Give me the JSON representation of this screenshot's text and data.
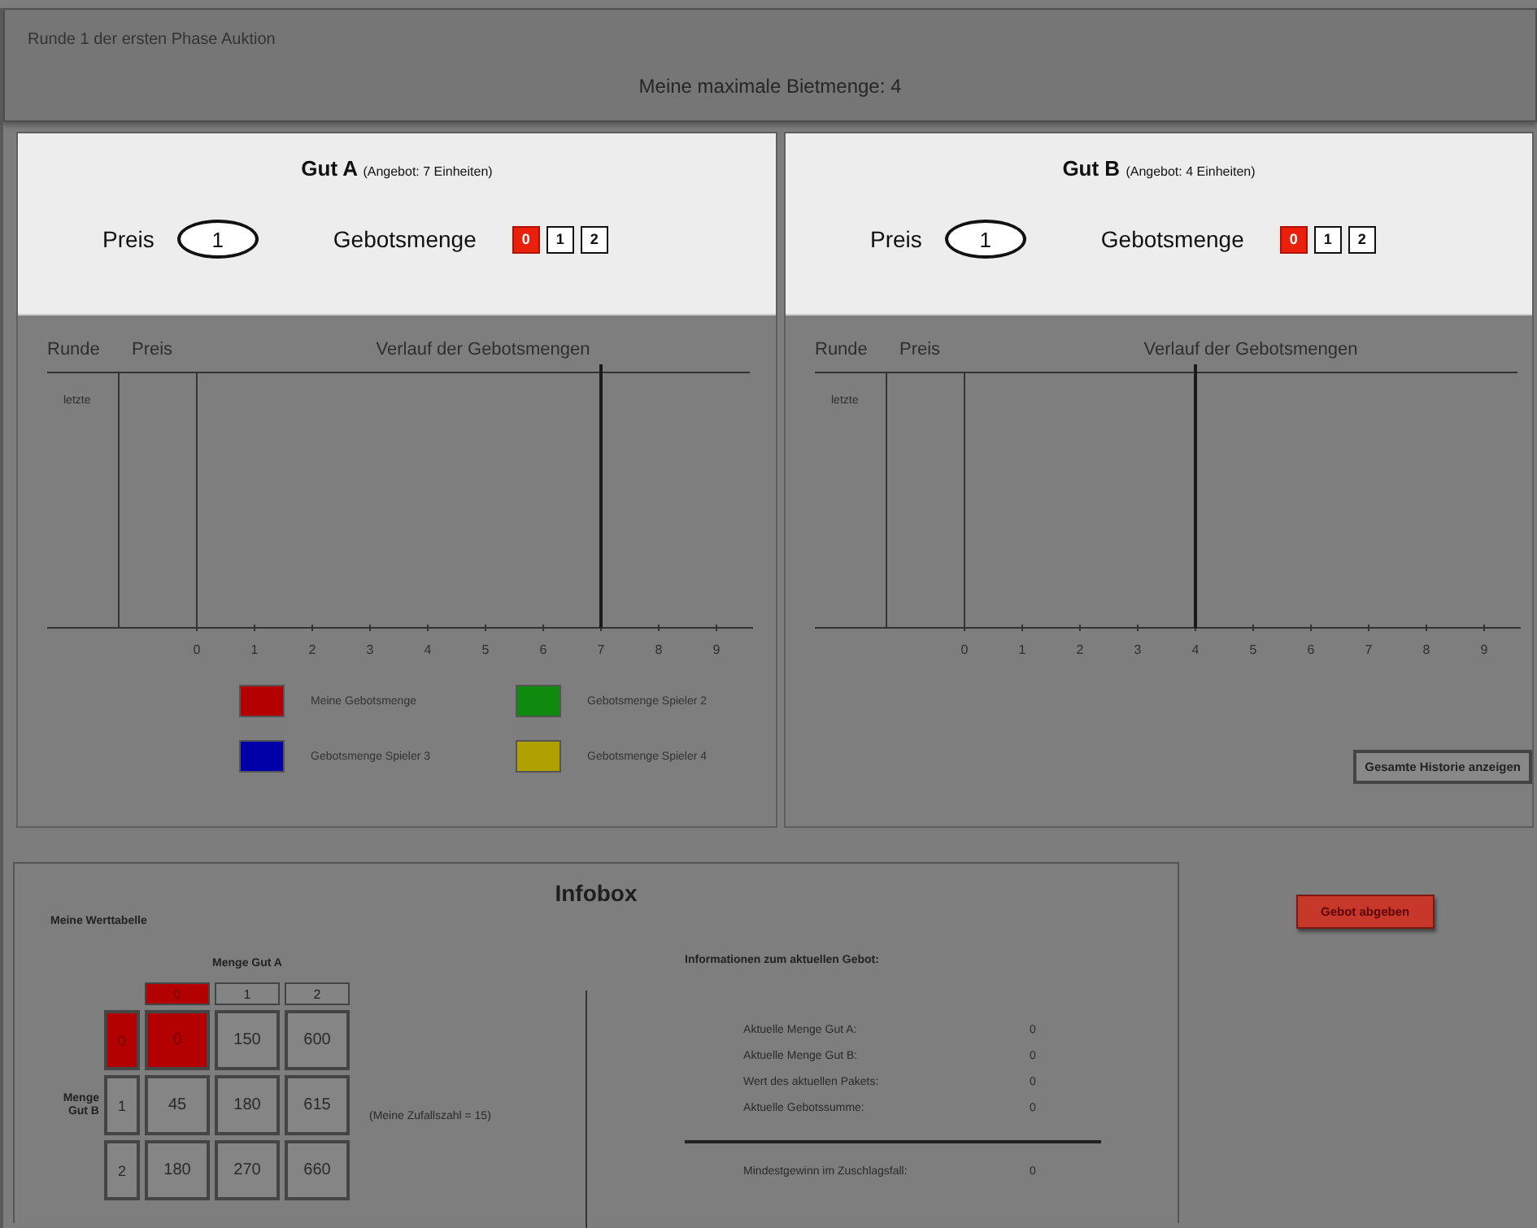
{
  "header": {
    "round_label": "Runde 1 der ersten Phase Auktion",
    "max_bid": "Meine maximale Bietmenge: 4"
  },
  "goods": [
    {
      "name": "Gut A",
      "supply": "(Angebot: 7 Einheiten)",
      "price_label": "Preis",
      "price": "1",
      "quantity_label": "Gebotsmenge",
      "quantities": [
        {
          "label": "0",
          "selected": true
        },
        {
          "label": "1",
          "selected": false
        },
        {
          "label": "2",
          "selected": false
        }
      ],
      "history": {
        "col_round": "Runde",
        "col_price": "Preis",
        "col_history": "Verlauf der Gebotsmengen",
        "row_label": "letzte",
        "ticks": [
          {
            "label": "0",
            "supply_line": false
          },
          {
            "label": "1",
            "supply_line": false
          },
          {
            "label": "2",
            "supply_line": false
          },
          {
            "label": "3",
            "supply_line": false
          },
          {
            "label": "4",
            "supply_line": false
          },
          {
            "label": "5",
            "supply_line": false
          },
          {
            "label": "6",
            "supply_line": false
          },
          {
            "label": "7",
            "supply_line": true
          },
          {
            "label": "8",
            "supply_line": false
          },
          {
            "label": "9",
            "supply_line": false
          }
        ]
      },
      "legend": [
        {
          "label": "Meine Gebotsmenge",
          "color": "#b40000"
        },
        {
          "label": "Gebotsmenge Spieler 2",
          "color": "#0f8a0f"
        },
        {
          "label": "Gebotsmenge Spieler 3",
          "color": "#0000a8"
        },
        {
          "label": "Gebotsmenge Spieler 4",
          "color": "#b0a000"
        }
      ]
    },
    {
      "name": "Gut B",
      "supply": "(Angebot: 4 Einheiten)",
      "price_label": "Preis",
      "price": "1",
      "quantity_label": "Gebotsmenge",
      "quantities": [
        {
          "label": "0",
          "selected": true
        },
        {
          "label": "1",
          "selected": false
        },
        {
          "label": "2",
          "selected": false
        }
      ],
      "history": {
        "col_round": "Runde",
        "col_price": "Preis",
        "col_history": "Verlauf der Gebotsmengen",
        "row_label": "letzte",
        "ticks": [
          {
            "label": "0",
            "supply_line": false
          },
          {
            "label": "1",
            "supply_line": false
          },
          {
            "label": "2",
            "supply_line": false
          },
          {
            "label": "3",
            "supply_line": false
          },
          {
            "label": "4",
            "supply_line": true
          },
          {
            "label": "5",
            "supply_line": false
          },
          {
            "label": "6",
            "supply_line": false
          },
          {
            "label": "7",
            "supply_line": false
          },
          {
            "label": "8",
            "supply_line": false
          },
          {
            "label": "9",
            "supply_line": false
          }
        ]
      },
      "button": "Gesamte Historie anzeigen"
    }
  ],
  "infobox": {
    "title": "Infobox",
    "value_table": {
      "title": "Meine Werttabelle",
      "col_axis": "Menge Gut A",
      "row_axis": "Menge Gut B",
      "columns": [
        {
          "label": "0",
          "selected": true
        },
        {
          "label": "1",
          "selected": false
        },
        {
          "label": "2",
          "selected": false
        }
      ],
      "rows": [
        {
          "label": "0",
          "selected": true,
          "cells": [
            "0",
            "150",
            "600"
          ]
        },
        {
          "label": "1",
          "selected": false,
          "cells": [
            "45",
            "180",
            "615"
          ]
        },
        {
          "label": "2",
          "selected": false,
          "cells": [
            "180",
            "270",
            "660"
          ]
        }
      ]
    },
    "random_number": "(Meine Zufallszahl = 15)",
    "info": {
      "title": "Informationen zum aktuellen Gebot:",
      "items": [
        {
          "label": "Aktuelle Menge Gut A:",
          "value": "0"
        },
        {
          "label": "Aktuelle Menge Gut B:",
          "value": "0"
        },
        {
          "label": "Wert des aktuellen Pakets:",
          "value": "0"
        },
        {
          "label": "Aktuelle Gebotssumme:",
          "value": "0"
        }
      ],
      "total": {
        "label": "Mindestgewinn im Zuschlagsfall:",
        "value": "0"
      }
    }
  },
  "submit_button": "Gebot abgeben"
}
